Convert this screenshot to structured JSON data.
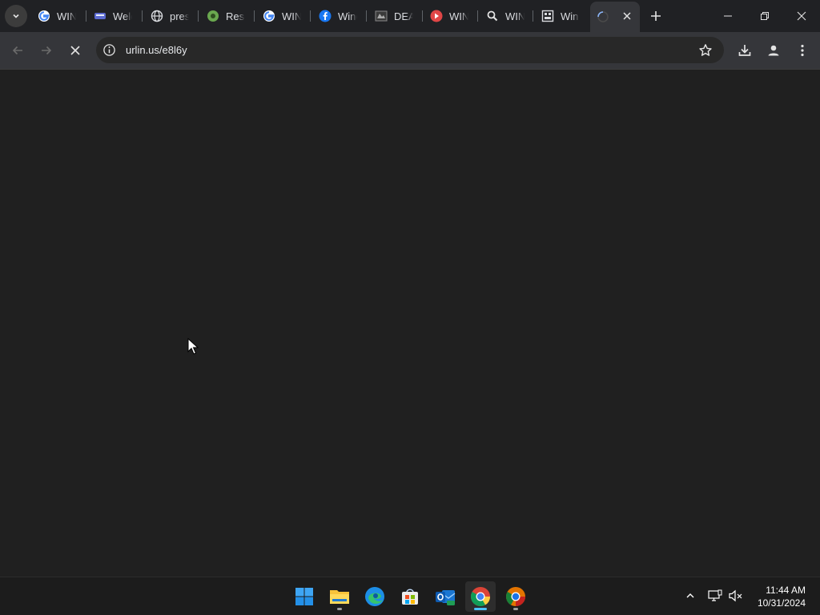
{
  "browser": {
    "tabs": [
      {
        "title": "WIN",
        "icon": "google-icon"
      },
      {
        "title": "Welc",
        "icon": "site-icon"
      },
      {
        "title": "pres",
        "icon": "globe-icon"
      },
      {
        "title": "Reso",
        "icon": "site-icon"
      },
      {
        "title": "WIN",
        "icon": "google-icon"
      },
      {
        "title": "Wind",
        "icon": "facebook-icon"
      },
      {
        "title": "DEA",
        "icon": "site-icon"
      },
      {
        "title": "WIN",
        "icon": "site-icon"
      },
      {
        "title": "WIN",
        "icon": "search-icon"
      },
      {
        "title": "Win",
        "icon": "site-icon"
      }
    ],
    "active_tab": {
      "icon": "loading-spinner-icon"
    },
    "address": "urlin.us/e8l6y",
    "accent": "#8ab4f8"
  },
  "taskbar": {
    "apps": [
      "start",
      "file-explorer",
      "edge",
      "microsoft-store",
      "outlook",
      "chrome",
      "chrome-canary"
    ],
    "clock_time": "11:44 AM",
    "clock_date": "10/31/2024"
  }
}
